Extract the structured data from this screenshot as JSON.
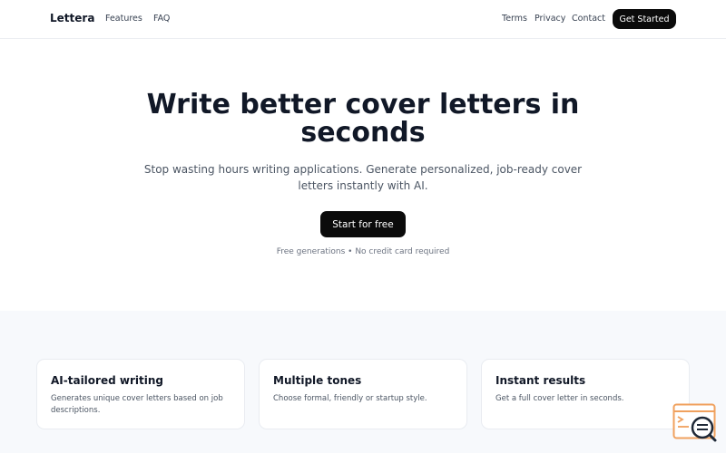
{
  "nav": {
    "brand": "Lettera",
    "links_left": [
      "Features",
      "FAQ"
    ],
    "links_right": [
      "Terms",
      "Privacy",
      "Contact"
    ],
    "cta": "Get Started"
  },
  "hero": {
    "title": "Write better cover letters in seconds",
    "subtitle": "Stop wasting hours writing applications. Generate personalized, job-ready cover letters instantly with AI.",
    "cta": "Start for free",
    "note": "Free generations • No credit card required"
  },
  "features": [
    {
      "title": "AI-tailored writing",
      "desc": "Generates unique cover letters based on job descriptions."
    },
    {
      "title": "Multiple tones",
      "desc": "Choose formal, friendly or startup style."
    },
    {
      "title": "Instant results",
      "desc": "Get a full cover letter in seconds."
    }
  ],
  "colors": {
    "primary": "#0b0b0b",
    "text": "#111827",
    "muted": "#4b5563",
    "section_bg": "#f7f9fc",
    "icon_accent": "#f0a15e"
  },
  "icons": {
    "floating": "code-search-icon"
  }
}
